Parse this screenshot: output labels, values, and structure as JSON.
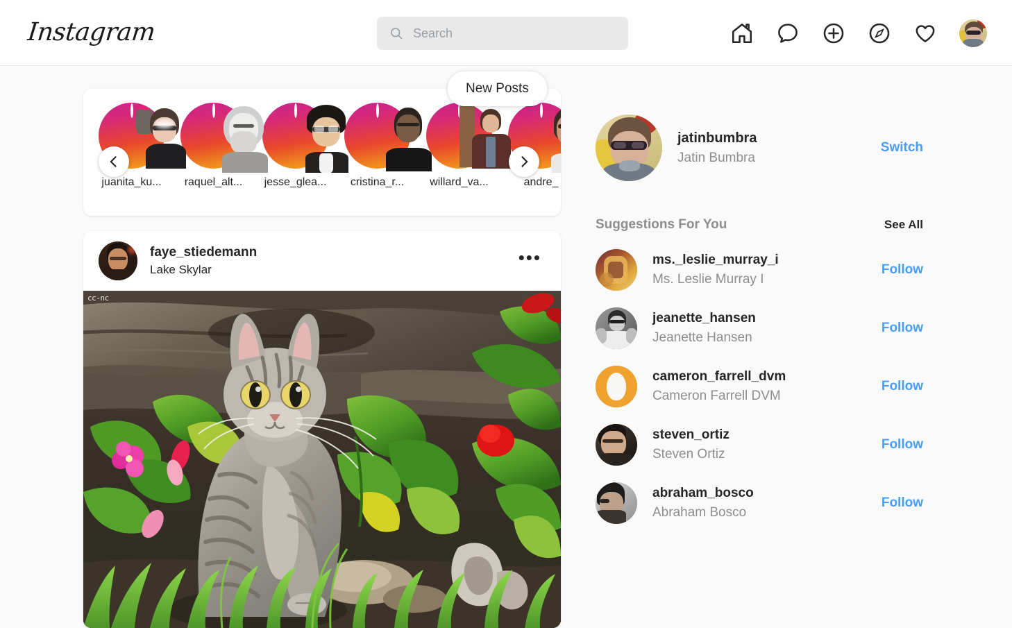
{
  "brand": {
    "name": "Instagram"
  },
  "search": {
    "placeholder": "Search",
    "value": "",
    "icon": "search-icon"
  },
  "nav": {
    "items": [
      {
        "icon": "home-icon",
        "label": "Home"
      },
      {
        "icon": "message-bubble-icon",
        "label": "Messages"
      },
      {
        "icon": "plus-circle-icon",
        "label": "New Post"
      },
      {
        "icon": "compass-icon",
        "label": "Explore"
      },
      {
        "icon": "heart-icon",
        "label": "Activity"
      }
    ],
    "avatar_label": "jatinbumbra"
  },
  "new_posts_badge": {
    "label": "New Posts"
  },
  "stories": {
    "prev_icon": "chevron-left-icon",
    "next_icon": "chevron-right-icon",
    "items": [
      {
        "username": "juanita_ku..."
      },
      {
        "username": "raquel_alt..."
      },
      {
        "username": "jesse_glea..."
      },
      {
        "username": "cristina_r..."
      },
      {
        "username": "willard_va..."
      },
      {
        "username": "andre_"
      }
    ]
  },
  "post": {
    "username": "faye_stiedemann",
    "location": "Lake Skylar",
    "menu_icon": "more-options-icon",
    "menu_label": "•••",
    "image_watermark": "cc-nc"
  },
  "account": {
    "username": "jatinbumbra",
    "fullname": "Jatin Bumbra",
    "switch_label": "Switch"
  },
  "suggestions": {
    "title": "Suggestions For You",
    "see_all_label": "See All",
    "follow_label": "Follow",
    "items": [
      {
        "username": "ms._leslie_murray_i",
        "fullname": "Ms. Leslie Murray I",
        "follow": "Follow"
      },
      {
        "username": "jeanette_hansen",
        "fullname": "Jeanette Hansen",
        "follow": "Follow"
      },
      {
        "username": "cameron_farrell_dvm",
        "fullname": "Cameron Farrell DVM",
        "follow": "Follow"
      },
      {
        "username": "steven_ortiz",
        "fullname": "Steven Ortiz",
        "follow": "Follow"
      },
      {
        "username": "abraham_bosco",
        "fullname": "Abraham Bosco",
        "follow": "Follow"
      }
    ]
  },
  "colors": {
    "page_background": "#fafafa",
    "card_background": "#ffffff",
    "link_blue": "#4a9df0",
    "muted_text": "#8e8e8e",
    "primary_text": "#262626",
    "story_ring_from": "#c9238f",
    "story_ring_to": "#f5a623",
    "search_background": "#e9e9e9"
  }
}
